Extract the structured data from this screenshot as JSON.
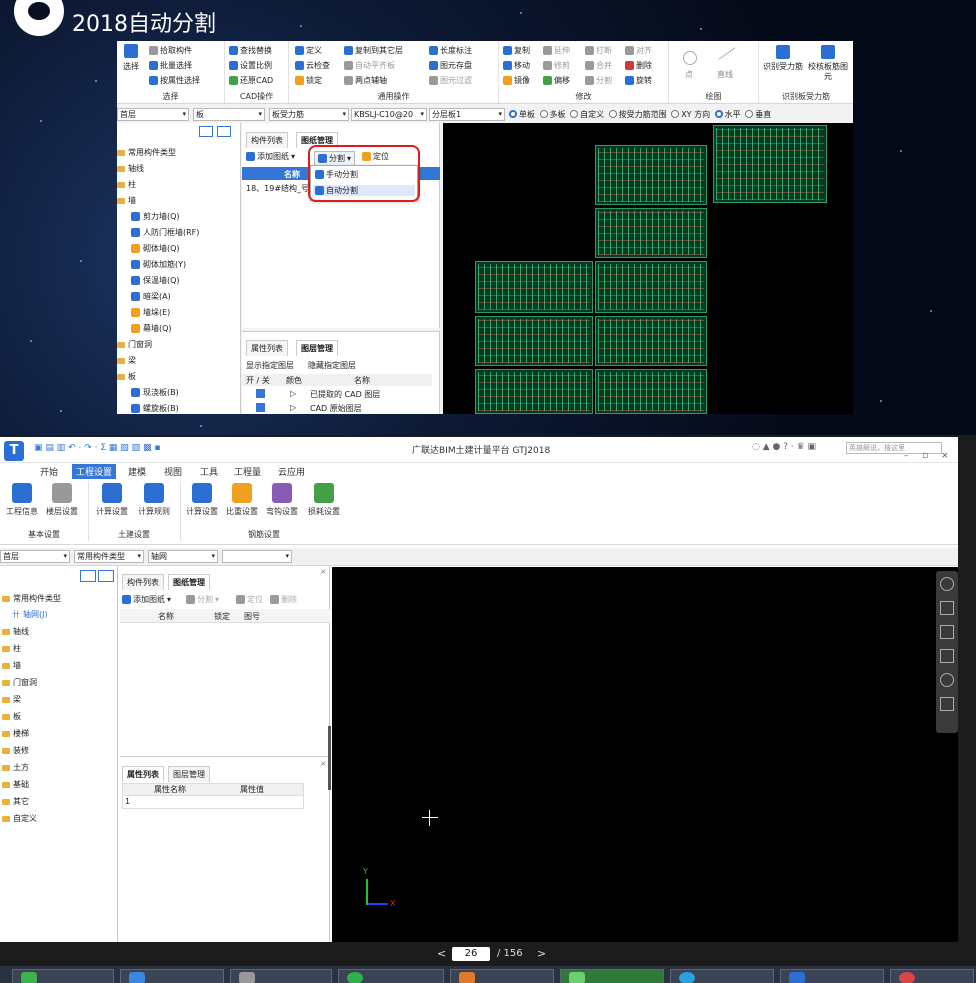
{
  "slide": {
    "title": "2018自动分割"
  },
  "top_window": {
    "ribbon": {
      "select_group": {
        "label": "选择",
        "big_button": "选择",
        "items": [
          "拾取构件",
          "批量选择",
          "按属性选择"
        ]
      },
      "cad_group": {
        "label": "CAD操作",
        "items": [
          "查找替换",
          "设置比例",
          "还原CAD"
        ]
      },
      "common_group": {
        "label": "通用操作",
        "items": [
          "定义",
          "云检查",
          "锁定",
          "复制到其它层",
          "自动平齐板",
          "两点辅轴",
          "长度标注",
          "图元存盘",
          "图元过滤"
        ]
      },
      "modify_group": {
        "label": "修改",
        "items": [
          "复制",
          "延伸",
          "打断",
          "对齐",
          "移动",
          "修剪",
          "合并",
          "删除",
          "镜像",
          "偏移",
          "分割",
          "旋转"
        ]
      },
      "draw_group": {
        "label": "绘图",
        "items": [
          "点",
          "直线"
        ]
      },
      "recognize_group": {
        "label": "识别板受力筋",
        "items": [
          "识别受力筋",
          "校核板筋图元"
        ]
      }
    },
    "filters": {
      "floor": "首层",
      "type": "板",
      "subtype": "板受力筋",
      "rebar": "KBSLJ-C10@20",
      "layer": "分层板1"
    },
    "options": {
      "slab_mode": [
        "单板",
        "多板",
        "自定义",
        "按受力筋范围"
      ],
      "direction": [
        "XY 方向",
        "水平",
        "垂直"
      ],
      "selected_slab_mode": "单板",
      "selected_direction": "水平"
    },
    "tree": {
      "categories": [
        "常用构件类型",
        "轴线",
        "柱",
        "墙"
      ],
      "wall_items": [
        "剪力墙(Q)",
        "人防门框墙(RF)",
        "砌体墙(Q)",
        "砌体加筋(Y)",
        "保温墙(Q)",
        "暗梁(A)",
        "墙垛(E)",
        "幕墙(Q)"
      ],
      "categories_after": [
        "门窗洞",
        "梁",
        "板"
      ],
      "slab_items": [
        "现浇板(B)",
        "螺旋板(B)"
      ]
    },
    "drawing_panel": {
      "tabs": [
        "构件列表",
        "图纸管理"
      ],
      "active_tab": "图纸管理",
      "toolbar": {
        "add": "添加图纸",
        "split": "分割",
        "locate": "定位"
      },
      "split_menu": [
        "手动分割",
        "自动分割"
      ],
      "column_name": "名称",
      "row_text": "18、19#结构_号"
    },
    "layer_panel": {
      "tabs": [
        "属性列表",
        "图层管理"
      ],
      "active_tab": "图层管理",
      "links": [
        "显示指定图层",
        "隐藏指定图层"
      ],
      "headers": [
        "开 / 关",
        "颜色",
        "名称"
      ],
      "rows": [
        "已提取的 CAD 图层",
        "CAD 原始图层"
      ]
    }
  },
  "app": {
    "title": "广联达BIM土建计量平台 GTJ2018",
    "search_placeholder": "英雄解说，搜这里",
    "menu": [
      "开始",
      "工程设置",
      "建模",
      "视图",
      "工具",
      "工程量",
      "云应用"
    ],
    "active_menu": "工程设置",
    "ribbon": {
      "basic": {
        "label": "基本设置",
        "buttons": [
          "工程信息",
          "楼层设置"
        ]
      },
      "civil": {
        "label": "土建设置",
        "buttons": [
          "计算设置",
          "计算规则"
        ]
      },
      "rebar": {
        "label": "钢筋设置",
        "buttons": [
          "计算设置",
          "比重设置",
          "弯钩设置",
          "损耗设置"
        ]
      }
    },
    "filters": {
      "floor": "首层",
      "category": "常用构件类型",
      "type": "轴网",
      "extra": ""
    },
    "tree": {
      "top": "常用构件类型",
      "child": "轴网(J)",
      "items": [
        "轴线",
        "柱",
        "墙",
        "门窗洞",
        "梁",
        "板",
        "楼梯",
        "装修",
        "土方",
        "基础",
        "其它",
        "自定义"
      ]
    },
    "drawing_panel": {
      "tabs": [
        "构件列表",
        "图纸管理"
      ],
      "active_tab": "图纸管理",
      "toolbar": [
        "添加图纸",
        "分割",
        "定位",
        "删除"
      ],
      "headers": [
        "名称",
        "锁定",
        "图号"
      ]
    },
    "prop_panel": {
      "tabs": [
        "属性列表",
        "图层管理"
      ],
      "active_tab": "属性列表",
      "headers": [
        "属性名称",
        "属性值"
      ],
      "row_index": "1"
    },
    "canvas": {
      "axis_x": "X",
      "axis_y": "Y"
    }
  },
  "pager": {
    "current": "26",
    "total": "/ 156",
    "prev": "<",
    "next": ">"
  }
}
